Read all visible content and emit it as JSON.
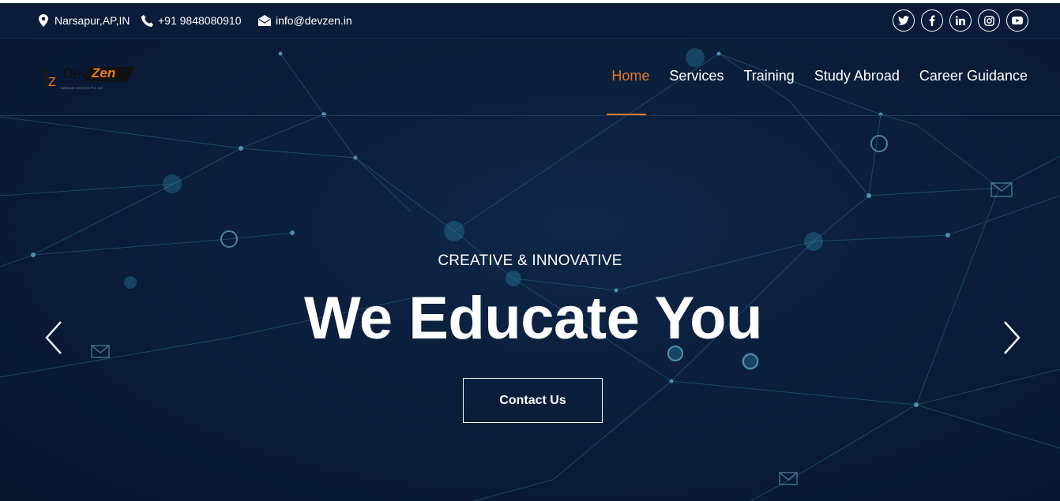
{
  "topbar": {
    "location": "Narsapur,AP,IN",
    "phone": "+91 9848080910",
    "email": "info@devzen.in"
  },
  "social": [
    {
      "icon": "twitter-icon",
      "glyph": "t"
    },
    {
      "icon": "facebook-icon",
      "glyph": "f"
    },
    {
      "icon": "linkedin-icon",
      "glyph": "in"
    },
    {
      "icon": "instagram-icon",
      "glyph": "◎"
    },
    {
      "icon": "youtube-icon",
      "glyph": "▶"
    }
  ],
  "logo": {
    "dev": "Dev",
    "zen": "Zen"
  },
  "nav": {
    "items": [
      "Home",
      "Services",
      "Training",
      "Study Abroad",
      "Career Guidance"
    ],
    "active": "Home"
  },
  "hero": {
    "subtitle": "CREATIVE & INNOVATIVE",
    "headline": "We Educate You",
    "cta": "Contact Us"
  },
  "colors": {
    "accent": "#e8782a",
    "background": "#0b1e3b",
    "topbar": "#0b1c3a"
  }
}
